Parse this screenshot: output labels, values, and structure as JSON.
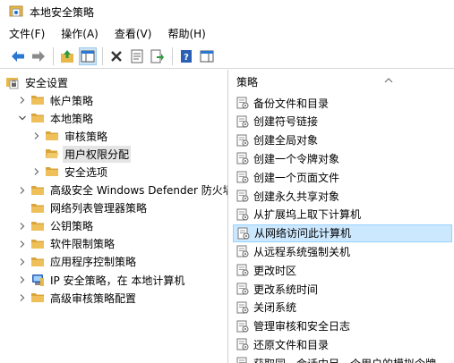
{
  "window": {
    "title": "本地安全策略"
  },
  "menu": [
    {
      "label": "文件(F)",
      "name": "menu-file"
    },
    {
      "label": "操作(A)",
      "name": "menu-action"
    },
    {
      "label": "查看(V)",
      "name": "menu-view"
    },
    {
      "label": "帮助(H)",
      "name": "menu-help"
    }
  ],
  "toolbar": {
    "buttons": [
      "back-icon",
      "forward-icon",
      "up-folder-icon",
      "show-tree-icon",
      "delete-icon",
      "properties-icon",
      "export-list-icon",
      "help-icon",
      "show-hide-pane-icon"
    ]
  },
  "tree": {
    "items": [
      {
        "label": "安全设置",
        "level": 0,
        "chevron": "",
        "icon": "security-settings-icon",
        "name": "tree-security-settings",
        "selected": false
      },
      {
        "label": "帐户策略",
        "level": 1,
        "chevron": "right",
        "icon": "folder-icon",
        "name": "tree-account-policies",
        "selected": false
      },
      {
        "label": "本地策略",
        "level": 1,
        "chevron": "down",
        "icon": "folder-icon",
        "name": "tree-local-policies",
        "selected": false
      },
      {
        "label": "审核策略",
        "level": 2,
        "chevron": "right",
        "icon": "folder-icon",
        "name": "tree-audit-policy",
        "selected": false
      },
      {
        "label": "用户权限分配",
        "level": 2,
        "chevron": "",
        "icon": "folder-open-icon",
        "name": "tree-user-rights-assignment",
        "selected": true
      },
      {
        "label": "安全选项",
        "level": 2,
        "chevron": "right",
        "icon": "folder-icon",
        "name": "tree-security-options",
        "selected": false
      },
      {
        "label": "高级安全 Windows Defender 防火墙",
        "level": 1,
        "chevron": "right",
        "icon": "folder-icon",
        "name": "tree-defender-firewall",
        "selected": false
      },
      {
        "label": "网络列表管理器策略",
        "level": 1,
        "chevron": "",
        "icon": "folder-icon",
        "name": "tree-network-list-manager",
        "selected": false
      },
      {
        "label": "公钥策略",
        "level": 1,
        "chevron": "right",
        "icon": "folder-icon",
        "name": "tree-public-key-policies",
        "selected": false
      },
      {
        "label": "软件限制策略",
        "level": 1,
        "chevron": "right",
        "icon": "folder-icon",
        "name": "tree-software-restriction",
        "selected": false
      },
      {
        "label": "应用程序控制策略",
        "level": 1,
        "chevron": "right",
        "icon": "folder-icon",
        "name": "tree-app-control",
        "selected": false
      },
      {
        "label": "IP 安全策略，在 本地计算机",
        "level": 1,
        "chevron": "right",
        "icon": "ip-security-icon",
        "name": "tree-ip-security",
        "selected": false
      },
      {
        "label": "高级审核策略配置",
        "level": 1,
        "chevron": "right",
        "icon": "folder-icon",
        "name": "tree-advanced-audit",
        "selected": false
      }
    ]
  },
  "list": {
    "header": "策略",
    "items": [
      {
        "label": "备份文件和目录",
        "selected": false
      },
      {
        "label": "创建符号链接",
        "selected": false
      },
      {
        "label": "创建全局对象",
        "selected": false
      },
      {
        "label": "创建一个令牌对象",
        "selected": false
      },
      {
        "label": "创建一个页面文件",
        "selected": false
      },
      {
        "label": "创建永久共享对象",
        "selected": false
      },
      {
        "label": "从扩展坞上取下计算机",
        "selected": false
      },
      {
        "label": "从网络访问此计算机",
        "selected": true
      },
      {
        "label": "从远程系统强制关机",
        "selected": false
      },
      {
        "label": "更改时区",
        "selected": false
      },
      {
        "label": "更改系统时间",
        "selected": false
      },
      {
        "label": "关闭系统",
        "selected": false
      },
      {
        "label": "管理审核和安全日志",
        "selected": false
      },
      {
        "label": "还原文件和目录",
        "selected": false
      },
      {
        "label": "获取同一会话中另一个用户的模拟令牌",
        "selected": false
      }
    ]
  },
  "colors": {
    "selection": "#cce8ff",
    "folder": "#e8b84a",
    "accent": "#1e6fd6"
  }
}
